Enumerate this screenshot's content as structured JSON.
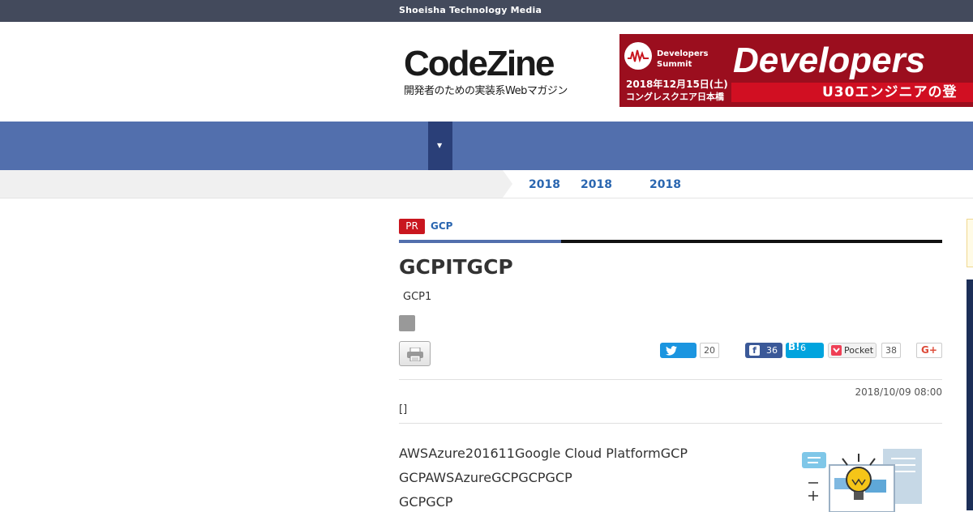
{
  "topbar": {
    "brand": "Shoeisha Technology Media"
  },
  "logo": {
    "main": "CodeZine",
    "tagline": "開発者のための実装系Webマガジン"
  },
  "banner": {
    "event_name_line1": "Developers",
    "event_name_line2": "Summit",
    "headline": "Developers",
    "date": "2018年12月15日(土)",
    "venue": "コングレスクエア日本橋",
    "subline": "U30エンジニアの登"
  },
  "nav": {
    "dropdown_icon": "▼"
  },
  "breadcrumb": {
    "items": [
      "2018",
      "2018",
      "2018"
    ]
  },
  "article": {
    "pr_badge": "PR",
    "category": "GCP",
    "title": "GCPITGCP",
    "subtitle": "GCP1",
    "date": "2018/10/09 08:00",
    "author_brackets": "[]",
    "paragraphs": [
      "AWSAzure201611Google Cloud PlatformGCP",
      "GCPAWSAzureGCPGCPGCP",
      "GCPGCP"
    ]
  },
  "share": {
    "twitter_count": "20",
    "facebook_count": "36",
    "hatena_label": "B!",
    "hatena_count": "6",
    "pocket_label": "Pocket",
    "pocket_count": "38",
    "gplus_label": "G+"
  },
  "colors": {
    "topbar": "#434a5c",
    "nav": "#526fad",
    "nav_dropdown": "#2a3f78",
    "pr_red": "#c9161f",
    "link_blue": "#2a66b0",
    "twitter": "#1b95e0",
    "facebook": "#3b5998",
    "hatena": "#00a4de"
  }
}
